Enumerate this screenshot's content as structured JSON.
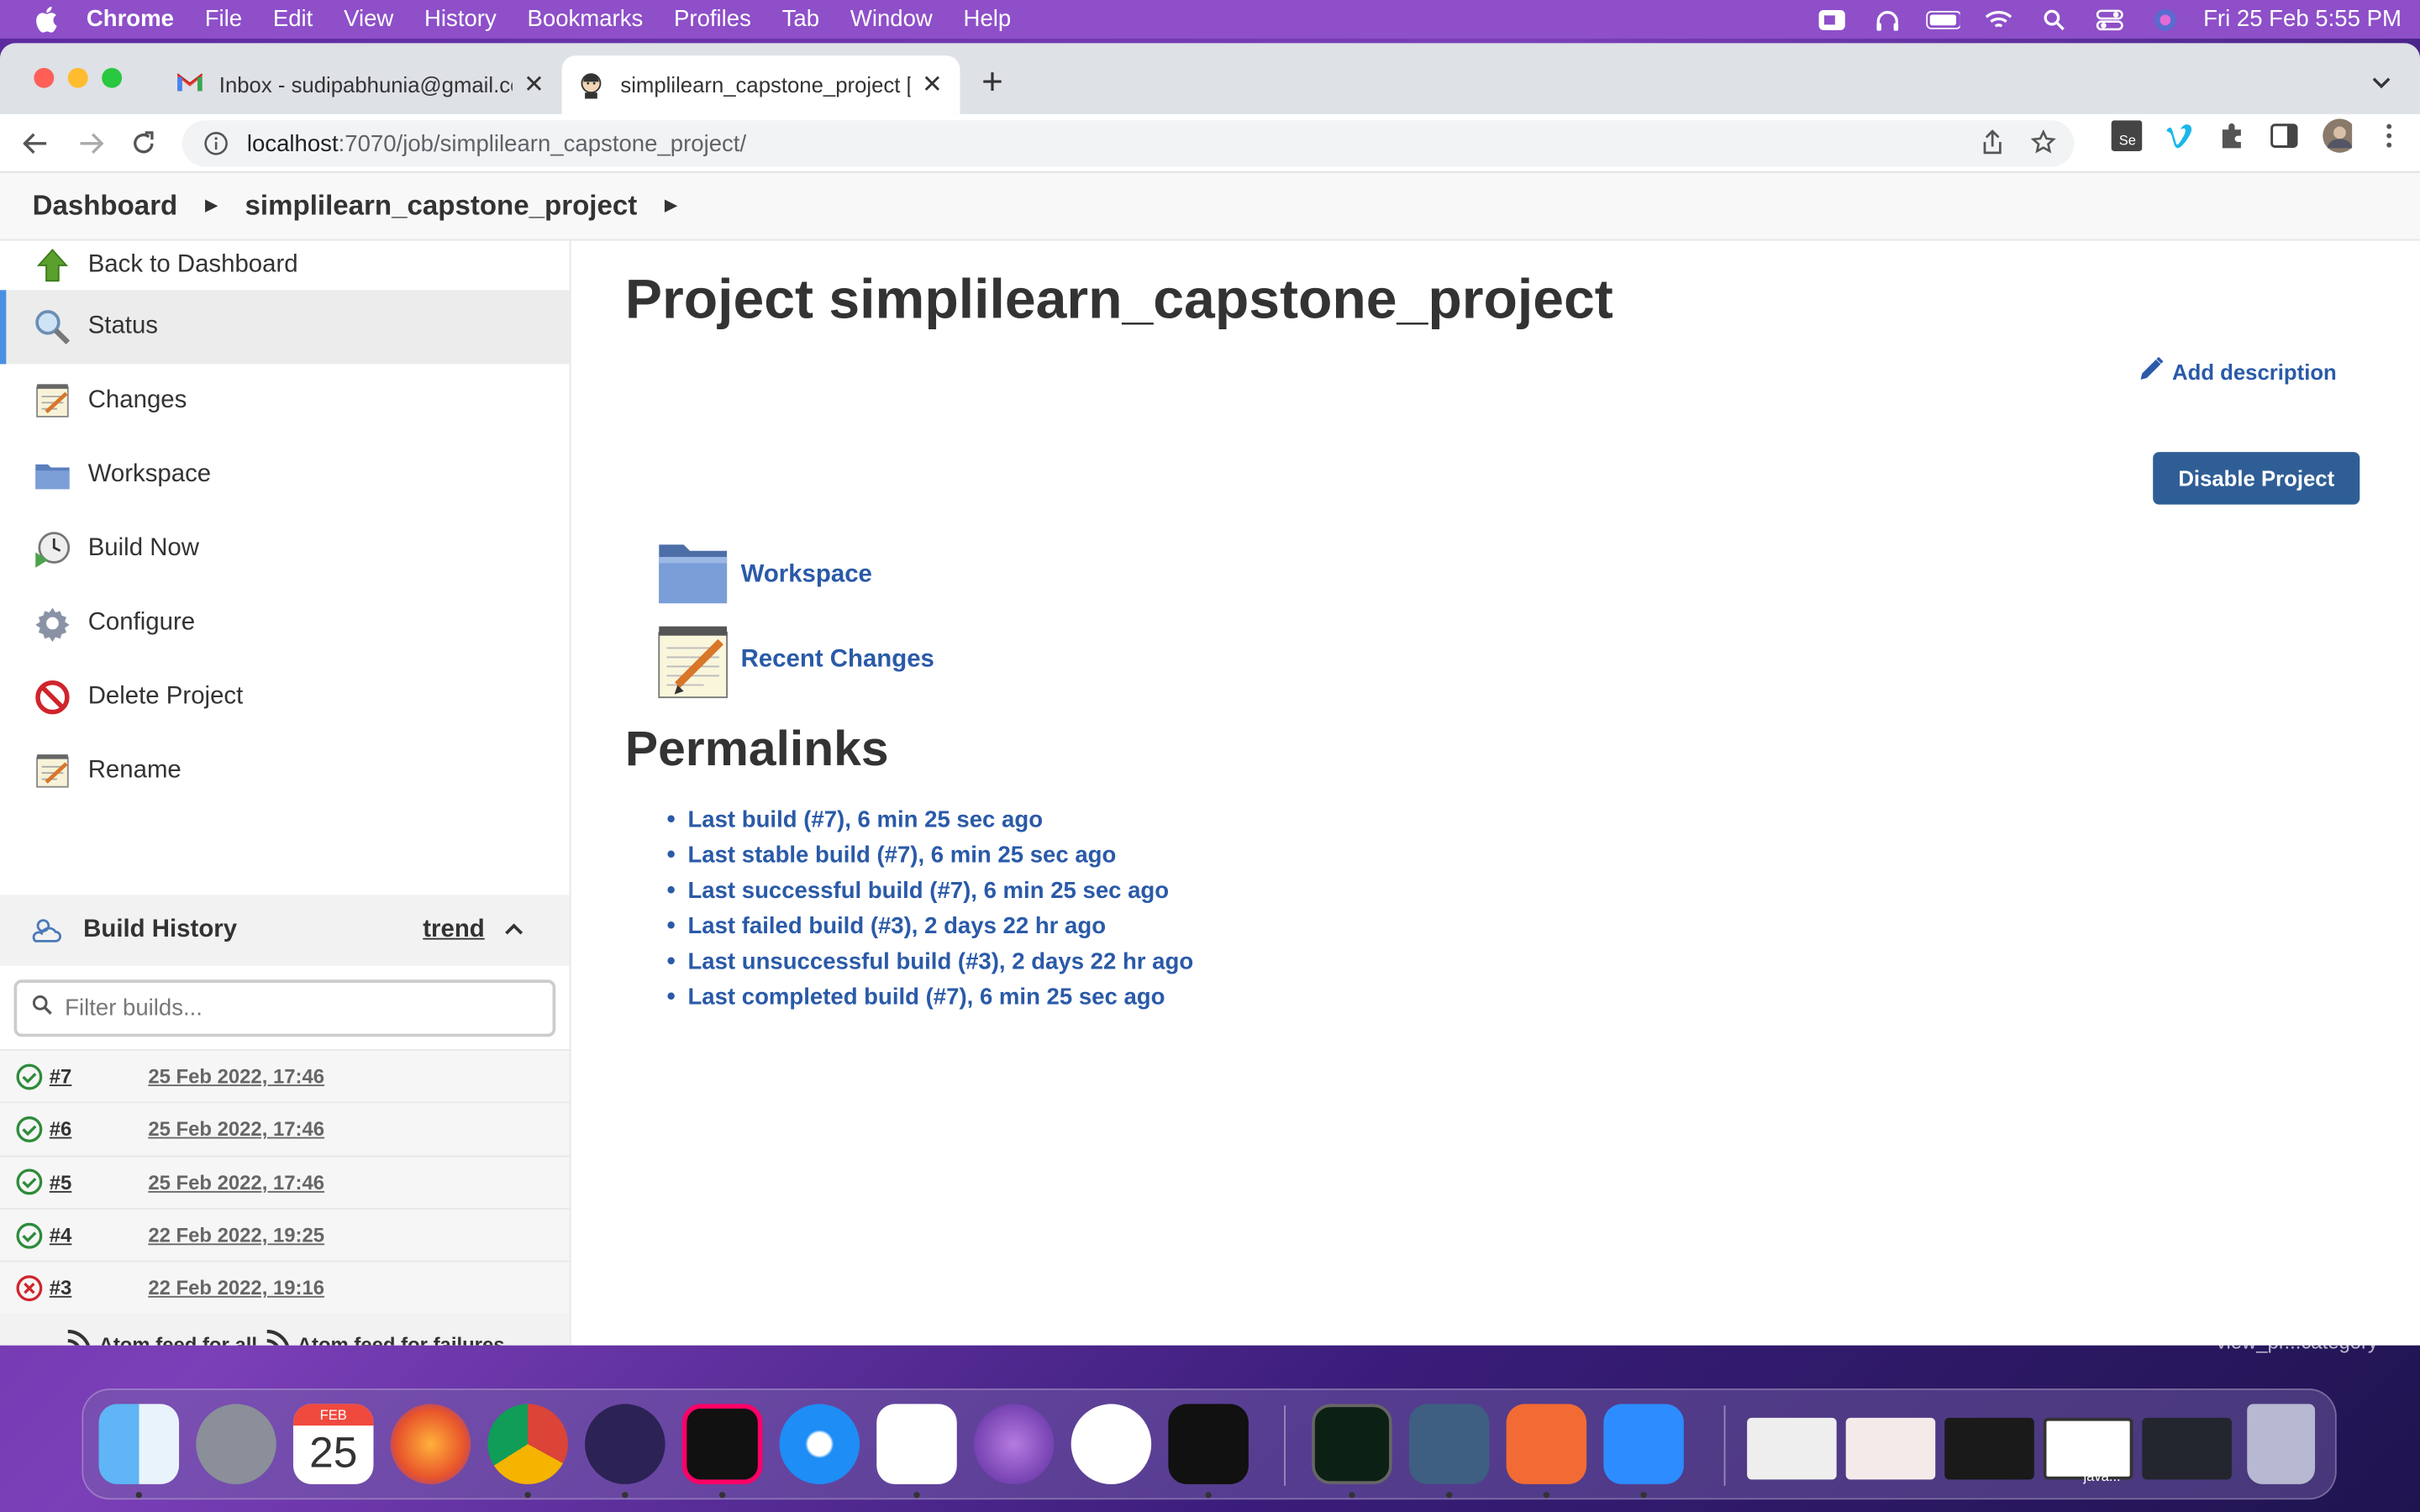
{
  "menubar": {
    "app_name": "Chrome",
    "items": [
      "File",
      "Edit",
      "View",
      "History",
      "Bookmarks",
      "Profiles",
      "Tab",
      "Window",
      "Help"
    ],
    "datetime": "Fri 25 Feb  5:55 PM"
  },
  "tabs": [
    {
      "title": "Inbox - sudipabhunia@gmail.co",
      "active": false
    },
    {
      "title": "simplilearn_capstone_project [",
      "active": true
    }
  ],
  "address": {
    "host": "localhost",
    "path": ":7070/job/simplilearn_capstone_project/"
  },
  "breadcrumb": {
    "root": "Dashboard",
    "project": "simplilearn_capstone_project"
  },
  "sidebar": {
    "items": [
      {
        "label": "Back to Dashboard",
        "icon": "up-arrow-icon"
      },
      {
        "label": "Status",
        "icon": "magnifier-icon"
      },
      {
        "label": "Changes",
        "icon": "notepad-icon"
      },
      {
        "label": "Workspace",
        "icon": "folder-icon"
      },
      {
        "label": "Build Now",
        "icon": "clock-play-icon"
      },
      {
        "label": "Configure",
        "icon": "gear-icon"
      },
      {
        "label": "Delete Project",
        "icon": "no-entry-icon"
      },
      {
        "label": "Rename",
        "icon": "notepad-icon"
      }
    ]
  },
  "build_history": {
    "title": "Build History",
    "trend": "trend",
    "filter_placeholder": "Filter builds...",
    "builds": [
      {
        "number": "#7",
        "date": "25 Feb 2022, 17:46",
        "status": "success"
      },
      {
        "number": "#6",
        "date": "25 Feb 2022, 17:46",
        "status": "success"
      },
      {
        "number": "#5",
        "date": "25 Feb 2022, 17:46",
        "status": "success"
      },
      {
        "number": "#4",
        "date": "22 Feb 2022, 19:25",
        "status": "success"
      },
      {
        "number": "#3",
        "date": "22 Feb 2022, 19:16",
        "status": "failed"
      }
    ],
    "feed_all": "Atom feed for all",
    "feed_failures": "Atom feed for failures"
  },
  "main": {
    "title": "Project simplilearn_capstone_project",
    "add_description": "Add description",
    "disable_button": "Disable Project",
    "links": {
      "workspace": "Workspace",
      "recent_changes": "Recent Changes"
    },
    "permalinks_title": "Permalinks",
    "permalinks": [
      "Last build (#7), 6 min 25 sec ago",
      "Last stable build (#7), 6 min 25 sec ago",
      "Last successful build (#7), 6 min 25 sec ago",
      "Last failed build (#3), 2 days 22 hr ago",
      "Last unsuccessful build (#3), 2 days 22 hr ago",
      "Last completed build (#7), 6 min 25 sec ago"
    ]
  },
  "desktop": {
    "window_label": "view_pr...category",
    "dock_thumb_label": "java..."
  },
  "colors": {
    "link": "#2a5aa8",
    "button": "#2f5e96",
    "success": "#2e8b3a",
    "failure": "#d0242c"
  }
}
